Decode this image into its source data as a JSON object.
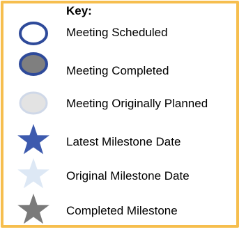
{
  "key": {
    "title": "Key:",
    "items": [
      {
        "label": "Meeting Scheduled",
        "icon": "open-circle-icon",
        "fill": "#ffffff",
        "stroke": "#2e4a9a"
      },
      {
        "label": "Meeting Completed",
        "icon": "gray-filled-circle-icon",
        "fill": "#7f7f7f",
        "stroke": "#2e4a9a"
      },
      {
        "label": "Meeting Originally Planned",
        "icon": "light-gray-circle-icon",
        "fill": "#e3e3e3",
        "stroke": "#cfd8e8"
      },
      {
        "label": "Latest Milestone Date",
        "icon": "blue-star-icon",
        "fill": "#3d5aae"
      },
      {
        "label": "Original Milestone Date",
        "icon": "light-blue-star-icon",
        "fill": "#dde8f5"
      },
      {
        "label": "Completed Milestone",
        "icon": "gray-star-icon",
        "fill": "#7a7a7a"
      }
    ]
  },
  "colors": {
    "border": "#f6be4e"
  }
}
